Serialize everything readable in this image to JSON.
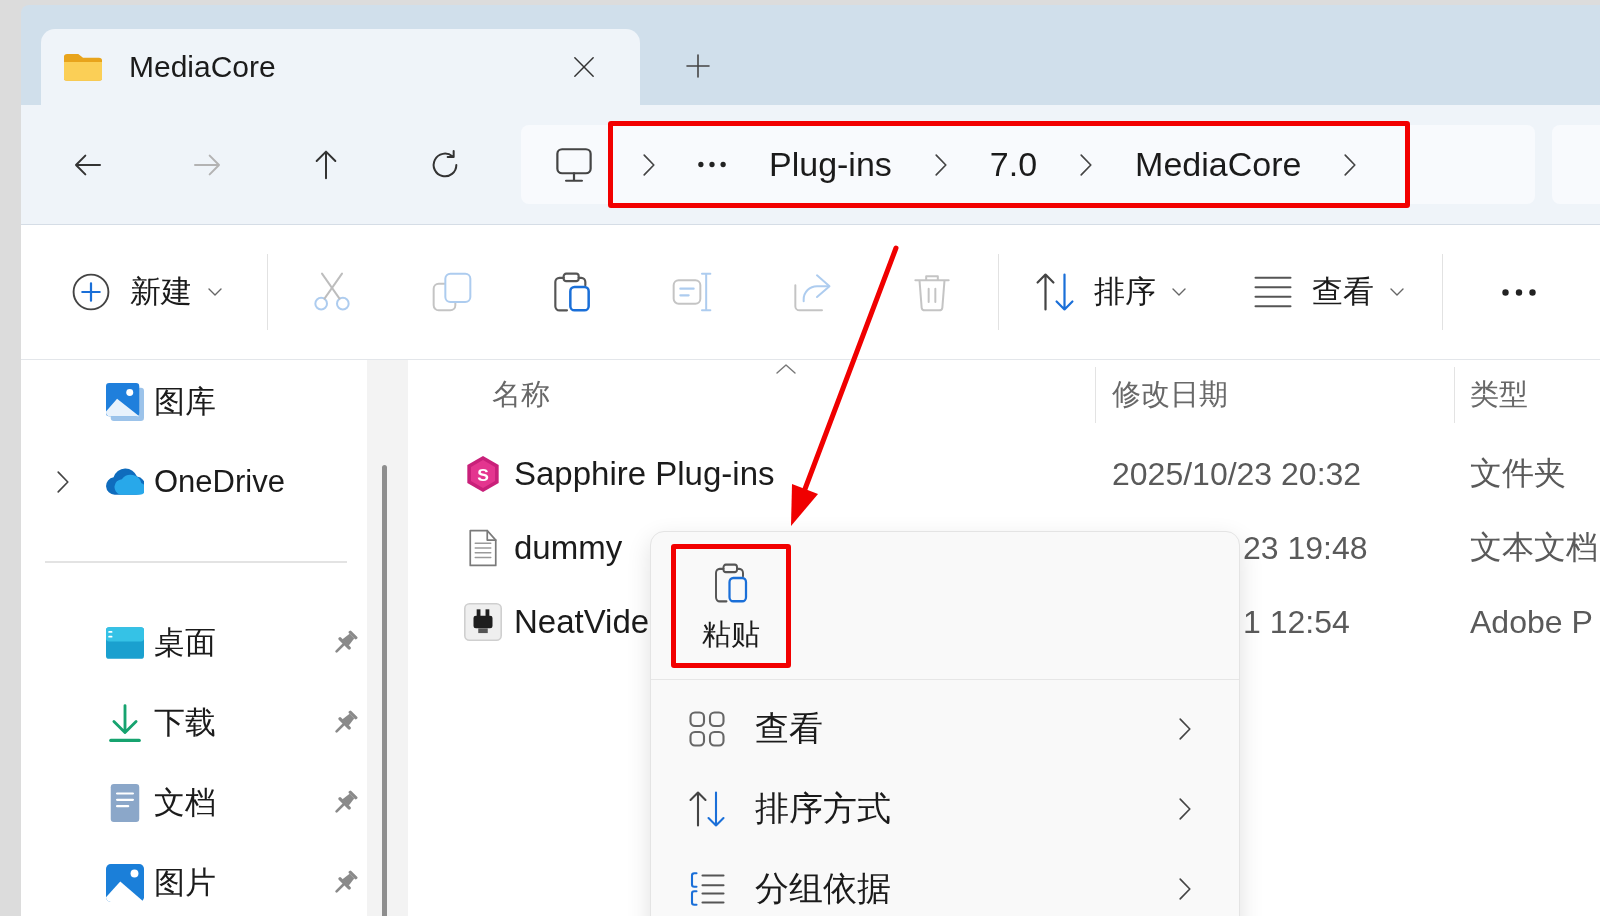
{
  "tabs": [
    {
      "title": "MediaCore",
      "selected": true
    }
  ],
  "nav_buttons": [
    {
      "kind": "back",
      "disabled": false
    },
    {
      "kind": "forward",
      "disabled": true
    },
    {
      "kind": "up",
      "disabled": false
    },
    {
      "kind": "refresh",
      "disabled": false
    }
  ],
  "address_bar": {
    "overflow": true,
    "crumbs": [
      "Plug-ins",
      "7.0",
      "MediaCore"
    ]
  },
  "command_bar": {
    "groups": [
      [
        {
          "kind": "new",
          "label": "新建",
          "disabled": false
        }
      ],
      [
        {
          "kind": "cut",
          "disabled": true
        },
        {
          "kind": "copy",
          "disabled": true
        },
        {
          "kind": "paste",
          "disabled": false
        },
        {
          "kind": "rename",
          "disabled": true
        },
        {
          "kind": "share",
          "disabled": true
        },
        {
          "kind": "delete",
          "disabled": true
        }
      ],
      [
        {
          "kind": "sort",
          "label": "排序",
          "disabled": false
        },
        {
          "kind": "view",
          "label": "查看",
          "disabled": false
        }
      ],
      [
        {
          "kind": "more",
          "disabled": false
        }
      ]
    ]
  },
  "sidebar": {
    "sections": [
      [
        {
          "kind": "gallery",
          "label": "图库",
          "expandable": false,
          "pinned": false
        },
        {
          "kind": "cloud",
          "label": "OneDrive",
          "expandable": true,
          "pinned": false
        }
      ],
      [
        {
          "kind": "desktop",
          "label": "桌面",
          "expandable": false,
          "pinned": true
        },
        {
          "kind": "downloads",
          "label": "下载",
          "expandable": false,
          "pinned": true
        },
        {
          "kind": "documents",
          "label": "文档",
          "expandable": false,
          "pinned": true
        },
        {
          "kind": "pictures",
          "label": "图片",
          "expandable": false,
          "pinned": true
        }
      ]
    ]
  },
  "file_list": {
    "columns": [
      {
        "label": "名称",
        "sorted": true
      },
      {
        "label": "修改日期",
        "sorted": false
      },
      {
        "label": "类型",
        "sorted": false
      }
    ],
    "rows": [
      {
        "kind": "app-folder",
        "icon_letter": "S",
        "name": "Sapphire Plug-ins",
        "modified": "2025/10/23 20:32",
        "type": "文件夹"
      },
      {
        "kind": "text",
        "name": "dummy",
        "modified": "23 19:48",
        "type": "文本文档"
      },
      {
        "kind": "plugin",
        "name": "NeatVide",
        "modified": "1 12:54",
        "type": "Adobe P"
      }
    ]
  },
  "context_menu": {
    "actions": [
      {
        "kind": "paste",
        "label": "粘贴"
      }
    ],
    "items": [
      {
        "kind": "view",
        "label": "查看",
        "submenu": true
      },
      {
        "kind": "sort",
        "label": "排序方式",
        "submenu": true
      },
      {
        "kind": "group",
        "label": "分组依据",
        "submenu": true
      }
    ]
  }
}
